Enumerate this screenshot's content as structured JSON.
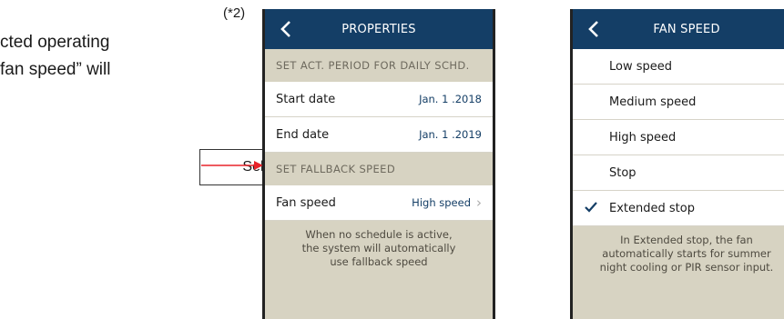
{
  "document": {
    "line1": "cted operating",
    "line2": "fan speed” will",
    "footnote_mark": "(*2)",
    "callout_label": "Select fan speed"
  },
  "properties_screen": {
    "title": "PROPERTIES",
    "section_daily": "SET ACT. PERIOD FOR DAILY SCHD.",
    "start_date_label": "Start date",
    "start_date_value": "Jan. 1 .2018",
    "end_date_label": "End date",
    "end_date_value": "Jan. 1 .2019",
    "section_fallback": "SET FALLBACK SPEED",
    "fan_speed_label": "Fan speed",
    "fan_speed_value": "High speed",
    "note_line1": "When no schedule is active,",
    "note_line2": "the system will automatically",
    "note_line3": "use fallback speed"
  },
  "fan_speed_screen": {
    "title": "FAN SPEED",
    "options": [
      "Low speed",
      "Medium speed",
      "High speed",
      "Stop",
      "Extended stop"
    ],
    "selected_option": "Extended stop",
    "note_line1": "In Extended stop, the fan",
    "note_line2": "automatically starts for summer",
    "note_line3": "night cooling or PIR sensor input."
  },
  "colors": {
    "header": "#143e66",
    "panel_bg": "#d7d3c2",
    "accent_arrow": "#e8232a"
  }
}
